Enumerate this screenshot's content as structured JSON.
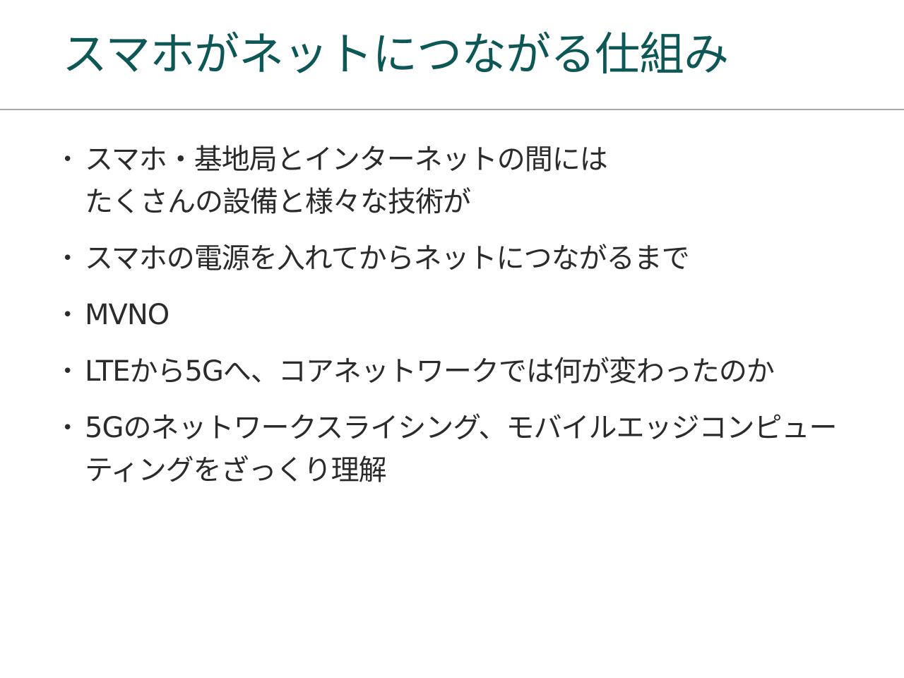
{
  "slide": {
    "title": "スマホがネットにつながる仕組み",
    "bullet_glyph": "•",
    "items": [
      "スマホ・基地局とインターネットの間には\nたくさんの設備と様々な技術が",
      "スマホの電源を入れてからネットにつながるまで",
      "MVNO",
      "LTEから5Gへ、コアネットワークでは何が変わったのか",
      "5Gのネットワークスライシング、モバイルエッジコンピュー\nティングをざっくり理解"
    ]
  },
  "colors": {
    "title": "#0d5856",
    "body_text": "#2b2b2b",
    "divider": "#a9a9a9",
    "background": "#ffffff"
  }
}
